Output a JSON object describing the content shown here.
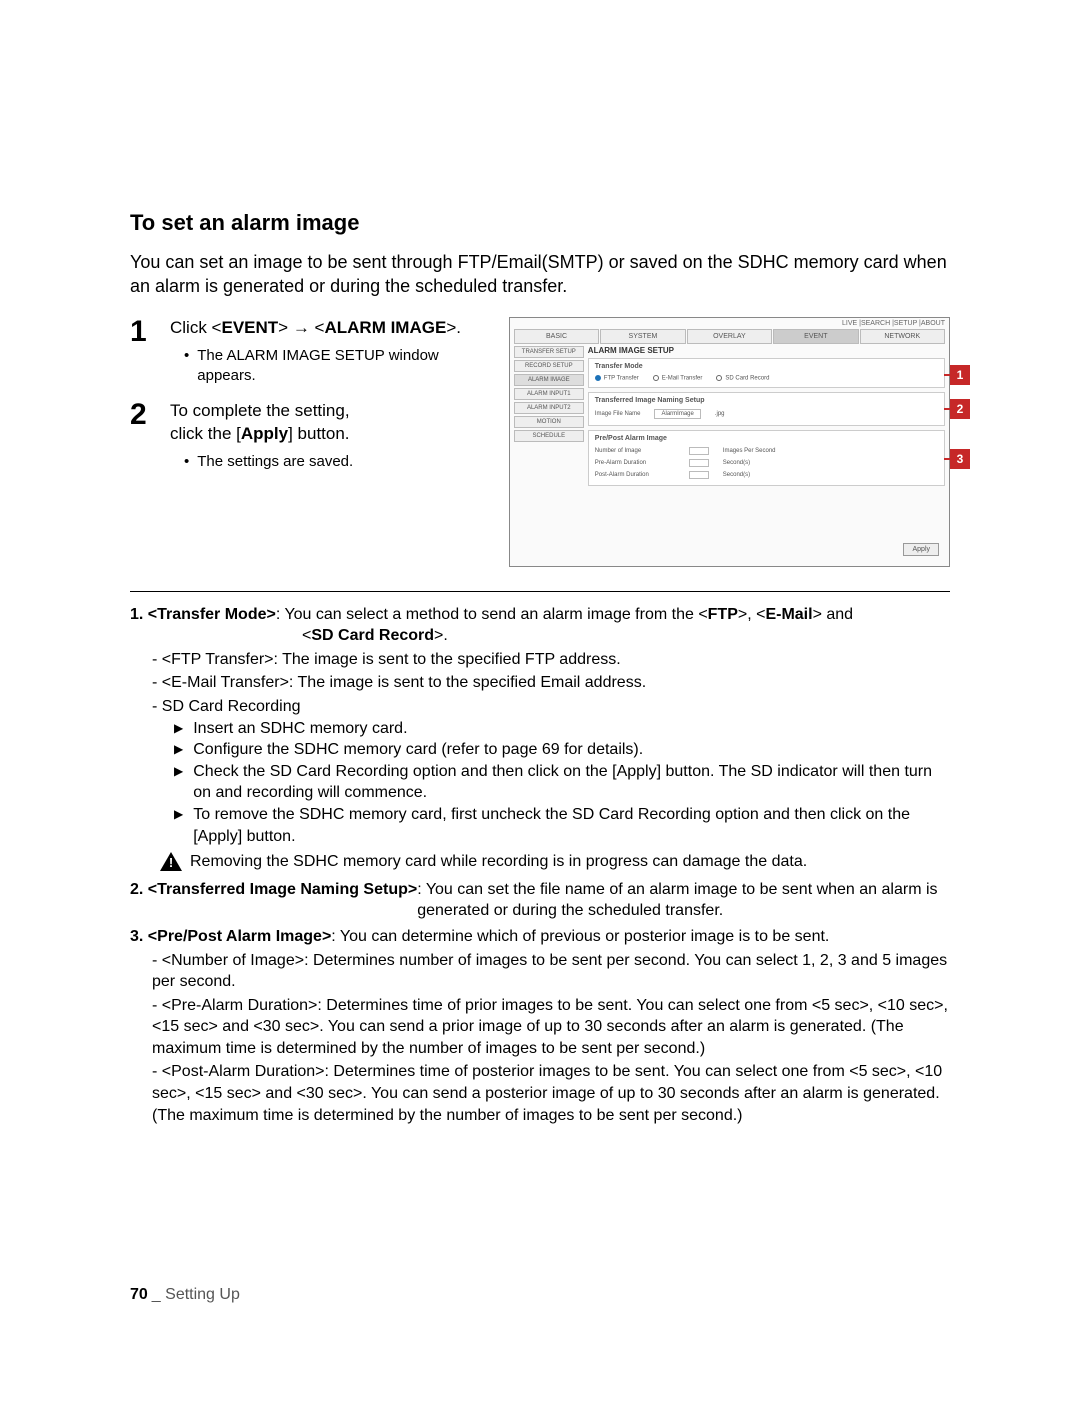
{
  "title": "To set an alarm image",
  "intro": "You can set an image to be sent through FTP/Email(SMTP) or saved on the SDHC memory card when an alarm is generated or during the scheduled transfer.",
  "steps": {
    "s1_prefix": "Click <",
    "s1_event": "EVENT",
    "s1_mid": "> ",
    "s1_arrow": "→",
    "s1_mid2": " <",
    "s1_alarm": "ALARM IMAGE",
    "s1_suffix": ">.",
    "s1_bullet": "The ALARM IMAGE SETUP window appears.",
    "s2_line1": "To complete the setting,",
    "s2_line2a": "click the [",
    "s2_apply": "Apply",
    "s2_line2b": "] button.",
    "s2_bullet": "The settings are saved."
  },
  "shot": {
    "topbar": "LIVE  |SEARCH |SETUP  |ABOUT",
    "tabs": [
      "BASIC",
      "SYSTEM",
      "OVERLAY",
      "EVENT",
      "NETWORK"
    ],
    "side": [
      "TRANSFER SETUP",
      "RECORD SETUP",
      "ALARM IMAGE",
      "ALARM INPUT1",
      "ALARM INPUT2",
      "MOTION",
      "SCHEDULE"
    ],
    "heading": "ALARM IMAGE SETUP",
    "p1_title": "Transfer Mode",
    "p1_opt1": "FTP Transfer",
    "p1_opt2": "E-Mail Transfer",
    "p1_opt3": "SD Card Record",
    "p2_title": "Transferred Image Naming Setup",
    "p2_label": "Image File Name",
    "p2_val": "AlarmImage",
    "p2_ext": ".jpg",
    "p3_title": "Pre/Post Alarm Image",
    "p3_r1a": "Number of Image",
    "p3_r1b": "Images Per Second",
    "p3_r2a": "Pre-Alarm Duration",
    "p3_r2b": "Second(s)",
    "p3_r3a": "Post-Alarm Duration",
    "p3_r3b": "Second(s)",
    "apply": "Apply",
    "c1": "1",
    "c2": "2",
    "c3": "3"
  },
  "desc": {
    "n1a": "1. ",
    "n1_label": "<Transfer Mode>",
    "n1b": ": You can select a method to send an alarm image from the <",
    "n1_ftp": "FTP",
    "n1c": ">, <",
    "n1_email": "E-Mail",
    "n1d": "> and",
    "n1_line2_pre": "<",
    "n1_sd": "SD Card Record",
    "n1_line2_post": ">.",
    "n1_s1": "- <FTP Transfer>: The image is sent to the specified FTP address.",
    "n1_s2": "- <E-Mail Transfer>: The image is sent to the specified Email address.",
    "n1_s3": "- SD Card Recording",
    "n1_t1": "Insert an SDHC memory card.",
    "n1_t2": "Configure the SDHC memory card (refer to page 69 for details).",
    "n1_t3": "Check the SD Card Recording option and then click on the [Apply] button. The SD indicator will then turn on and recording will commence.",
    "n1_t4": "To remove the SDHC memory card, first uncheck the SD Card Recording option and then click on the [Apply] button.",
    "warn": "Removing the SDHC memory card while recording is in progress can damage the data.",
    "n2a": "2. ",
    "n2_label": "<Transferred Image Naming Setup>",
    "n2b": ": You can set the file name of an alarm image to be sent when an alarm is generated or during the scheduled transfer.",
    "n3a": "3. ",
    "n3_label": "<Pre/Post Alarm Image>",
    "n3b": ": You can determine which of previous or posterior image is to be sent.",
    "n3_s1": "- <Number of Image>: Determines number of images to be sent per second. You can select 1, 2, 3 and 5 images per second.",
    "n3_s2": "- <Pre-Alarm Duration>: Determines time of prior images to be sent. You can select one from <5 sec>, <10 sec>, <15 sec> and <30 sec>. You can send a prior image of up to 30 seconds after an alarm is generated. (The maximum time is determined by the number of images to be sent per second.)",
    "n3_s3": "- <Post-Alarm Duration>: Determines time of posterior images to be sent. You can select one from <5 sec>, <10 sec>, <15 sec> and <30 sec>. You can send a posterior image of up to 30 seconds after an alarm is generated. (The maximum time is determined by the number of images to be sent per second.)"
  },
  "footer": {
    "page": "70",
    "label": "_ Setting Up"
  }
}
